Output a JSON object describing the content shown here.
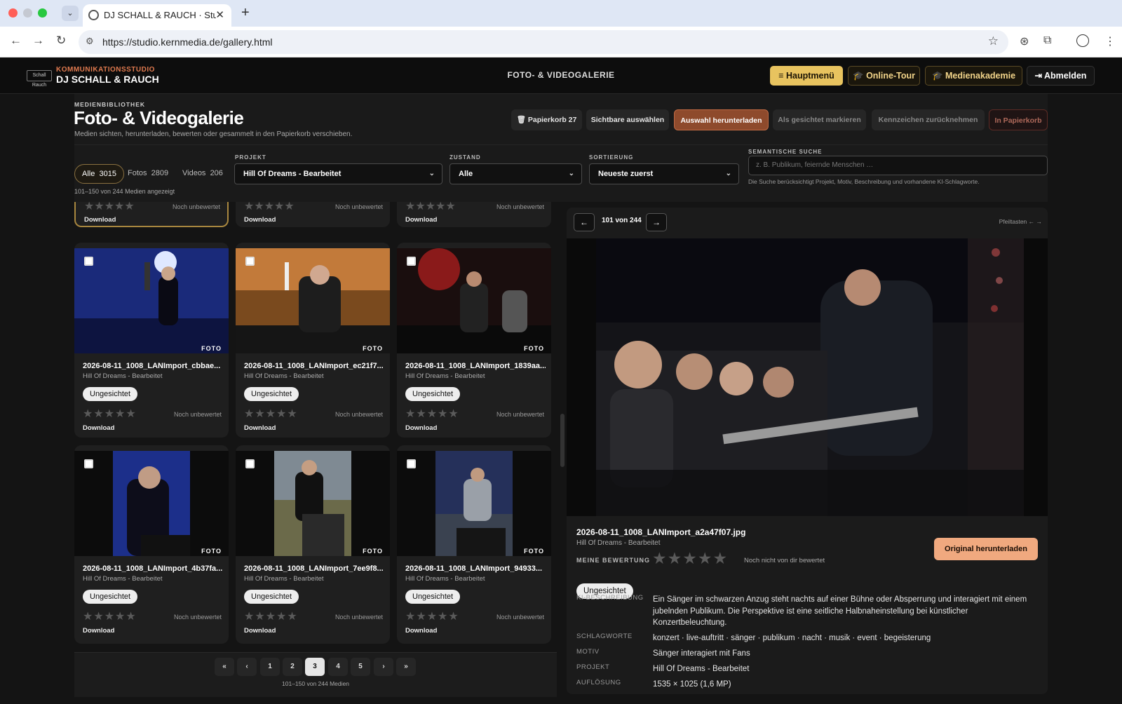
{
  "browser": {
    "tab_title": "DJ SCHALL & RAUCH · Studio",
    "url": "https://studio.kernmedia.de/gallery.html"
  },
  "header": {
    "brand_sub": "KOMMUNIKATIONSSTUDIO",
    "brand_main": "DJ SCHALL & RAUCH",
    "center_title": "FOTO- & VIDEOGALERIE",
    "buttons": {
      "menu": "≡ Hauptmenü",
      "tour": "🎓 Online-Tour",
      "academy": "🎓 Medienakademie",
      "logout": "⇥ Abmelden"
    }
  },
  "page": {
    "kicker": "MEDIENBIBLIOTHEK",
    "title": "Foto- & Videogalerie",
    "subtitle": "Medien sichten, herunterladen, bewerten oder gesammelt in den Papierkorb verschieben."
  },
  "actions": {
    "trash": "🗑 Papierkorb 27",
    "select_visible": "Sichtbare auswählen",
    "download_selection": "Auswahl herunterladen",
    "mark_viewed": "Als gesichtet markieren",
    "unmark": "Kennzeichen zurücknehmen",
    "to_trash": "In Papierkorb"
  },
  "filters": {
    "segments": [
      {
        "label": "Alle",
        "count": "3015"
      },
      {
        "label": "Fotos",
        "count": "2809"
      },
      {
        "label": "Videos",
        "count": "206"
      }
    ],
    "shown": "101–150 von 244 Medien angezeigt",
    "project_label": "PROJEKT",
    "project_value": "Hill Of Dreams - Bearbeitet",
    "state_label": "ZUSTAND",
    "state_value": "Alle",
    "sort_label": "SORTIERUNG",
    "sort_value": "Neueste zuerst",
    "search_label": "SEMANTISCHE SUCHE",
    "search_placeholder": "z. B. Publikum, feiernde Menschen …",
    "search_hint": "Die Suche berücksichtigt Projekt, Motiv, Beschreibung und vorhandene KI-Schlagworte."
  },
  "card_common": {
    "project": "Hill Of Dreams - Bearbeitet",
    "status": "Ungesichtet",
    "stars": "★★★★★",
    "rating": "Noch unbewertet",
    "download": "Download",
    "badge": "FOTO"
  },
  "cards": [
    {
      "filename": "2026-08-11_1008_LANImport_cbbae..."
    },
    {
      "filename": "2026-08-11_1008_LANImport_ec21f7..."
    },
    {
      "filename": "2026-08-11_1008_LANImport_1839aa..."
    },
    {
      "filename": "2026-08-11_1008_LANImport_4b37fa..."
    },
    {
      "filename": "2026-08-11_1008_LANImport_7ee9f8..."
    },
    {
      "filename": "2026-08-11_1008_LANImport_94933..."
    }
  ],
  "pagination": {
    "pages": [
      "«",
      "‹",
      "1",
      "2",
      "3",
      "4",
      "5",
      "›",
      "»"
    ],
    "current": "3",
    "summary": "101–150 von 244 Medien"
  },
  "viewer": {
    "prev": "←",
    "next": "→",
    "counter": "101 von 244",
    "hint": "Pfeiltasten ← →",
    "filename": "2026-08-11_1008_LANImport_a2a47f07.jpg",
    "project": "Hill Of Dreams - Bearbeitet",
    "rating_label": "MEINE BEWERTUNG",
    "stars": "★★★★★",
    "rating_text": "Noch nicht von dir bewertet",
    "download": "Original herunterladen",
    "status": "Ungesichtet",
    "meta": {
      "desc_label": "KI-BESCHREIBUNG",
      "desc": "Ein Sänger im schwarzen Anzug steht nachts auf einer Bühne oder Absperrung und interagiert mit einem jubelnden Publikum. Die Perspektive ist eine seitliche Halbnaheinstellung bei künstlicher Konzertbeleuchtung.",
      "tags_label": "SCHLAGWORTE",
      "tags": "konzert · live-auftritt · sänger · publikum · nacht · musik · event · begeisterung",
      "motif_label": "MOTIV",
      "motif": "Sänger interagiert mit Fans",
      "project_label": "PROJEKT",
      "project": "Hill Of Dreams - Bearbeitet",
      "res_label": "AUFLÖSUNG",
      "res": "1535 × 1025 (1,6 MP)"
    }
  }
}
